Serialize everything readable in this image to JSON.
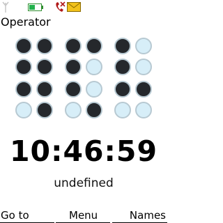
{
  "status_bar": {
    "icons": [
      "signal-icon",
      "battery-icon",
      "missed-call-icon",
      "message-icon"
    ],
    "operator": "Operator"
  },
  "clock": {
    "time": "10:46:59",
    "date_text": "undefined",
    "binary_columns": [
      [
        1,
        1,
        1,
        0
      ],
      [
        1,
        1,
        1,
        1
      ],
      [
        1,
        1,
        1,
        0
      ],
      [
        1,
        0,
        0,
        1
      ],
      [
        1,
        1,
        1,
        0
      ],
      [
        0,
        0,
        1,
        0
      ]
    ],
    "colors": {
      "on": "#25282c",
      "off": "#d7eef8",
      "ring": "#b7c9d2"
    }
  },
  "softkeys": {
    "left": "Go to",
    "middle": "Menu",
    "right": "Names"
  }
}
